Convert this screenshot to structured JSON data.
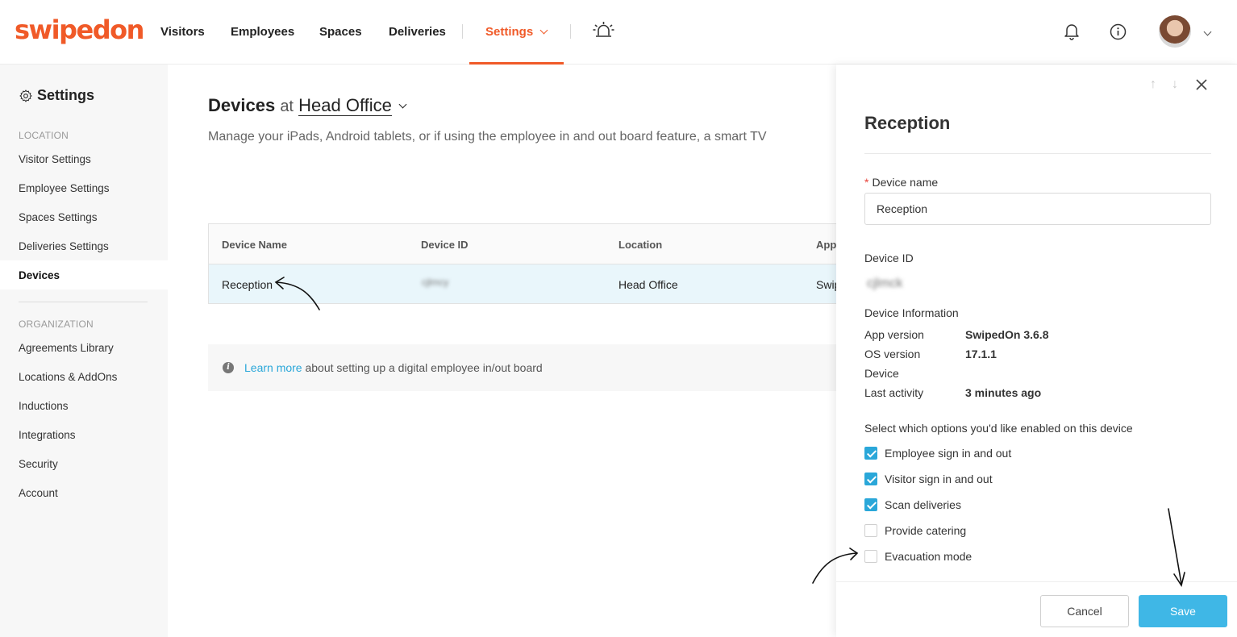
{
  "brand": {
    "logo_text": "swipedon",
    "accent": "#f05a28",
    "link": "#2aa7d9",
    "button": "#3fb7e6"
  },
  "topnav": {
    "items": [
      {
        "label": "Visitors"
      },
      {
        "label": "Employees"
      },
      {
        "label": "Spaces"
      },
      {
        "label": "Deliveries"
      },
      {
        "label": "Settings"
      }
    ],
    "icons": [
      "evacuation-alarm-icon",
      "bell-icon",
      "info-icon",
      "avatar",
      "chevron-down-icon"
    ]
  },
  "sidebar": {
    "title": "Settings",
    "location_heading": "LOCATION",
    "location_items": [
      {
        "label": "Visitor Settings"
      },
      {
        "label": "Employee Settings"
      },
      {
        "label": "Spaces Settings"
      },
      {
        "label": "Deliveries Settings"
      },
      {
        "label": "Devices"
      }
    ],
    "organization_heading": "ORGANIZATION",
    "organization_items": [
      {
        "label": "Agreements Library"
      },
      {
        "label": "Locations & AddOns"
      },
      {
        "label": "Inductions"
      },
      {
        "label": "Integrations"
      },
      {
        "label": "Security"
      },
      {
        "label": "Account"
      }
    ]
  },
  "main": {
    "title_bold": "Devices",
    "title_at": "at",
    "title_location": "Head Office",
    "subtitle": "Manage your iPads, Android tablets, or if using the employee in and out board feature, a smart TV",
    "table": {
      "headers": [
        "Device Name",
        "Device ID",
        "Location",
        "App"
      ],
      "rows": [
        {
          "name": "Reception",
          "device_id": "cjlmcy",
          "location": "Head Office",
          "app": "Swip"
        }
      ]
    },
    "info": {
      "link": "Learn more",
      "text": "about setting up a digital employee in/out board"
    }
  },
  "panel": {
    "title": "Reception",
    "device_name_label": "Device name",
    "device_name_value": "Reception",
    "device_id_label": "Device ID",
    "device_id_value": "cjlmck",
    "device_info_label": "Device Information",
    "info_rows": [
      {
        "key": "App version",
        "value": "SwipedOn 3.6.8"
      },
      {
        "key": "OS version",
        "value": "17.1.1"
      },
      {
        "key": "Device",
        "value": ""
      },
      {
        "key": "Last activity",
        "value": "3 minutes ago"
      }
    ],
    "options_label": "Select which options you'd like enabled on this device",
    "options": [
      {
        "label": "Employee sign in and out",
        "checked": true
      },
      {
        "label": "Visitor sign in and out",
        "checked": true
      },
      {
        "label": "Scan deliveries",
        "checked": true
      },
      {
        "label": "Provide catering",
        "checked": false
      },
      {
        "label": "Evacuation mode",
        "checked": false
      }
    ],
    "cancel_label": "Cancel",
    "save_label": "Save"
  }
}
